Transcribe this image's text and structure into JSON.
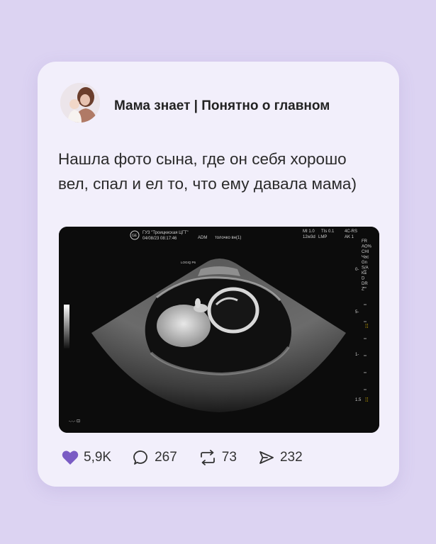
{
  "post": {
    "channel_name": "Мама знает | Понятно о главном",
    "text": "Нашла фото сына, где он себя хорошо вел, спал и ел то, что ему давала мама)"
  },
  "ultrasound": {
    "clinic": "ГУЗ \"Троицкеская ЦГТ\"",
    "datetime": "04/08/23 08:17:46",
    "operator": "ADM",
    "note": "толочко вн(1)",
    "mi": "MI 1.0",
    "tis": "TIs 0.1",
    "probe": "4C-RS",
    "ga": "12w3d",
    "lmp": "LMP",
    "ak": "AK 1",
    "right_panel": [
      "FR",
      "AO%",
      "CHI",
      "Час",
      "Gn",
      "S/A",
      "Ка",
      "D",
      "DR",
      "Z"
    ],
    "depth_labels": [
      "0-",
      "5-",
      "1-",
      "1.5"
    ],
    "logo_label": "LOGIQ P6",
    "bottom_left": "-.-.- ⊡"
  },
  "actions": {
    "likes": "5,9K",
    "comments": "267",
    "reposts": "73",
    "shares": "232"
  },
  "colors": {
    "background": "#dcd3f2",
    "card": "#f2effb",
    "heart": "#7a5cc4"
  }
}
